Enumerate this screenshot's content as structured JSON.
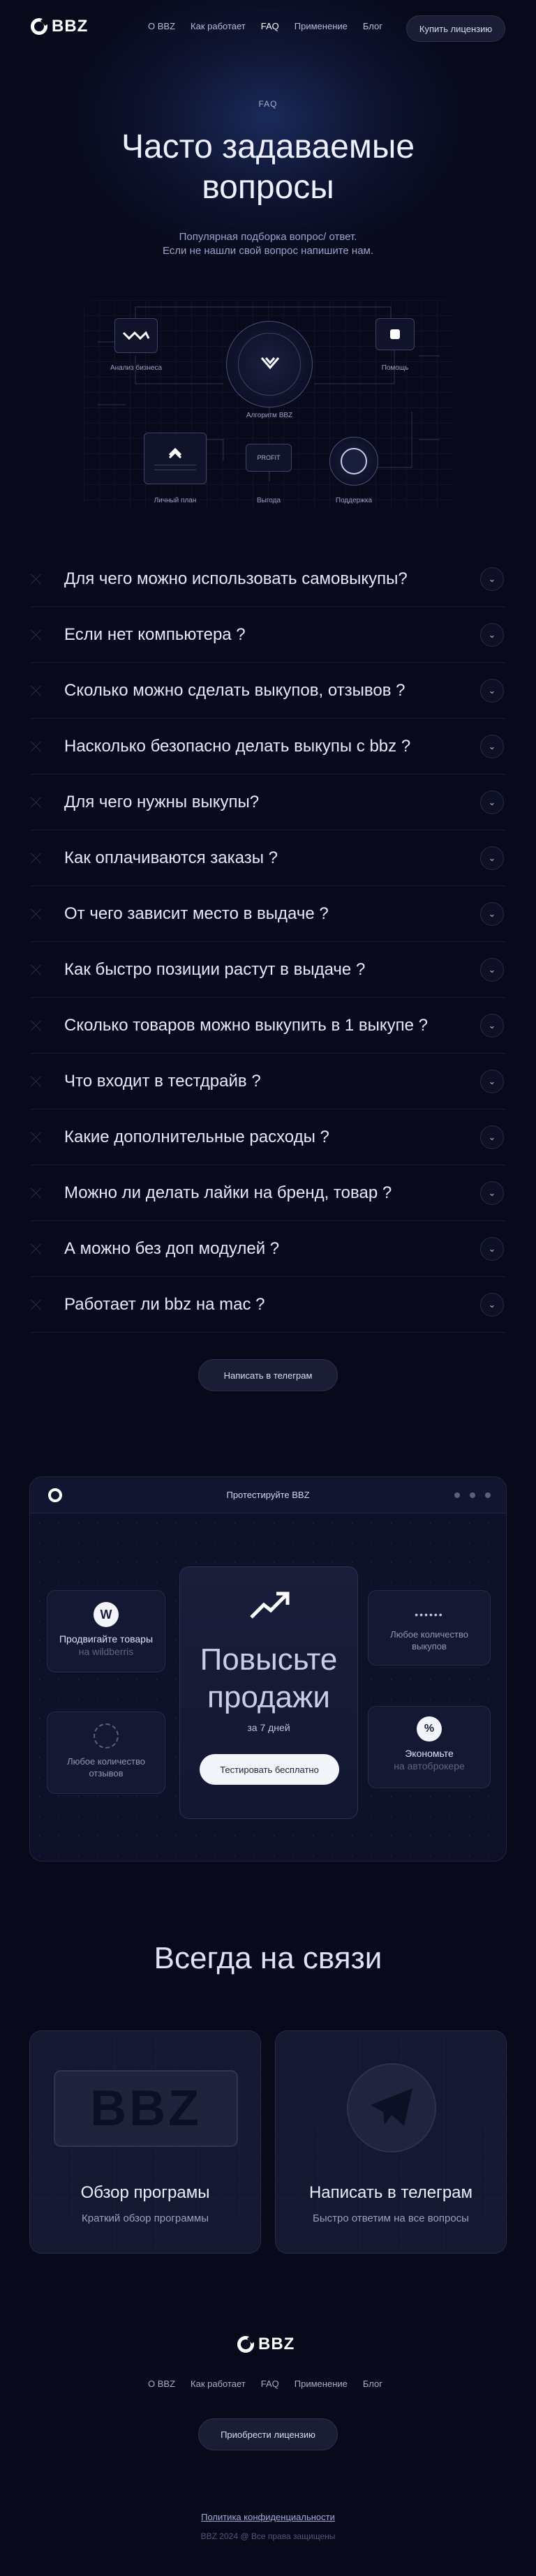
{
  "header": {
    "logo": "BBZ",
    "nav": [
      "О BBZ",
      "Как работает",
      "FAQ",
      "Применение",
      "Блог"
    ],
    "buy_button": "Купить лицензию"
  },
  "hero": {
    "tag": "FAQ",
    "title_line1": "Часто задаваемые",
    "title_line2": "вопросы",
    "subtitle_line1": "Популярная подборка вопрос/ ответ.",
    "subtitle_line2": "Если не нашли свой вопрос напишите нам."
  },
  "illustration": {
    "labels": [
      "Анализ бизнеса",
      "Алгоритм BBZ",
      "Помощь",
      "Личный план",
      "Выгода",
      "Поддержка"
    ],
    "chip_text": "PROFIT"
  },
  "faq": [
    "Для чего можно использовать самовыкупы?",
    "Если нет компьютера ?",
    "Сколько можно сделать выкупов, отзывов ?",
    "Насколько безопасно делать выкупы с bbz ?",
    "Для чего нужны выкупы?",
    "Как оплачиваются заказы ?",
    "От чего зависит место в выдаче ?",
    "Как быстро позиции растут в выдаче ?",
    "Сколько товаров можно выкупить в 1 выкупе ?",
    "Что входит в тестдрайв ?",
    "Какие дополнительные расходы ?",
    "Можно ли делать лайки на бренд, товар ?",
    "А можно без доп модулей ?",
    "Работает ли bbz на mac ?"
  ],
  "telegram_button": "Написать в телеграм",
  "test_panel": {
    "title": "Протестируйте BBZ",
    "card1_title": "Продвигайте товары",
    "card1_sub": "на wildberris",
    "card1_icon": "W",
    "card2_title": "Любое количество",
    "card2_sub": "отзывов",
    "card3_dots": "••••••",
    "card3_title": "Любое количество",
    "card3_sub": "выкупов",
    "card4_title": "Экономьте",
    "card4_sub": "на автоброкере",
    "center_title_line1": "Повысьте",
    "center_title_line2": "продажи",
    "center_sub": "за 7 дней",
    "center_button": "Тестировать бесплатно"
  },
  "always": {
    "title": "Всегда на связи",
    "card_left_logo": "BBZ",
    "card_left_title": "Обзор програмы",
    "card_left_sub": "Краткий обзор программы",
    "card_right_title": "Написать в телеграм",
    "card_right_sub": "Быстро ответим на все вопросы"
  },
  "footer": {
    "logo": "BBZ",
    "nav": [
      "О BBZ",
      "Как работает",
      "FAQ",
      "Применение",
      "Блог"
    ],
    "license_button": "Приобрести лицензию",
    "policy": "Политика конфиденциальности",
    "copyright": "BBZ 2024 @ Все права защищены"
  }
}
